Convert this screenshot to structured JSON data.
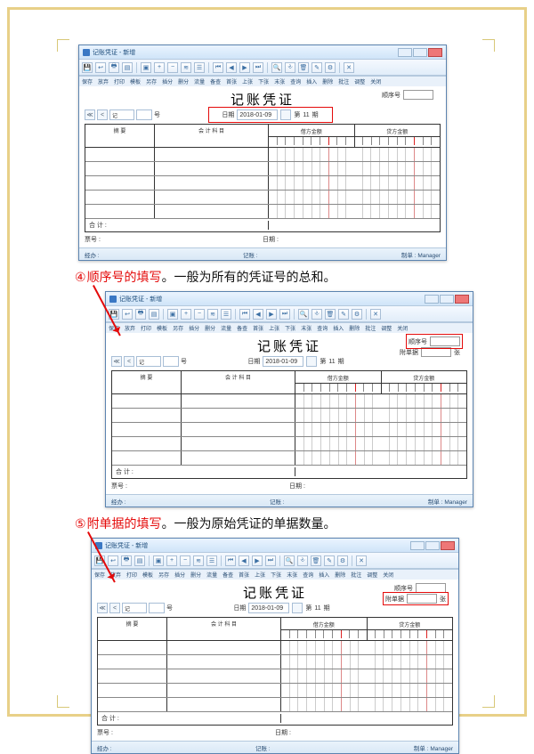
{
  "page": {
    "cap4_num": "④",
    "cap4_key": "顺序号的填写",
    "cap4_rest": "。一般为所有的凭证号的总和。",
    "cap5_num": "⑤",
    "cap5_key": "附单据的填写",
    "cap5_rest": "。一般为原始凭证的单据数量。"
  },
  "app": {
    "window_title": "记账凭证 - 新增",
    "win_min": "—",
    "win_max": "□",
    "menu": [
      "保存",
      "放弃",
      "打印",
      "模板",
      "另存",
      "插分",
      "删分",
      "流量",
      "备查",
      "首张",
      "上张",
      "下张",
      "末张",
      "查询",
      "插入",
      "删除",
      "批注",
      "调整",
      "关闭"
    ],
    "doc_title": "记账凭证",
    "nav_prev2": "≪",
    "nav_prev": "<",
    "type_label": "记",
    "seq_suffix": "号",
    "date_label": "日期",
    "date_value": "2018-01-09",
    "period_prefix": "第",
    "period_value": "11",
    "period_suffix": "期",
    "seqno_label": "顺序号",
    "attach_label": "附单据",
    "attach_unit": "张",
    "col_summary": "摘  要",
    "col_subject": "会 计 科 目",
    "col_debit": "借方金额",
    "col_credit": "贷方金额",
    "total_label": "合  计 :",
    "footer_bill": "票号 :",
    "footer_date": "日期 :",
    "sb_jingban": "经办 :",
    "sb_review": "记账 :",
    "sb_maker_label": "制单 :",
    "sb_maker": "Manager"
  }
}
